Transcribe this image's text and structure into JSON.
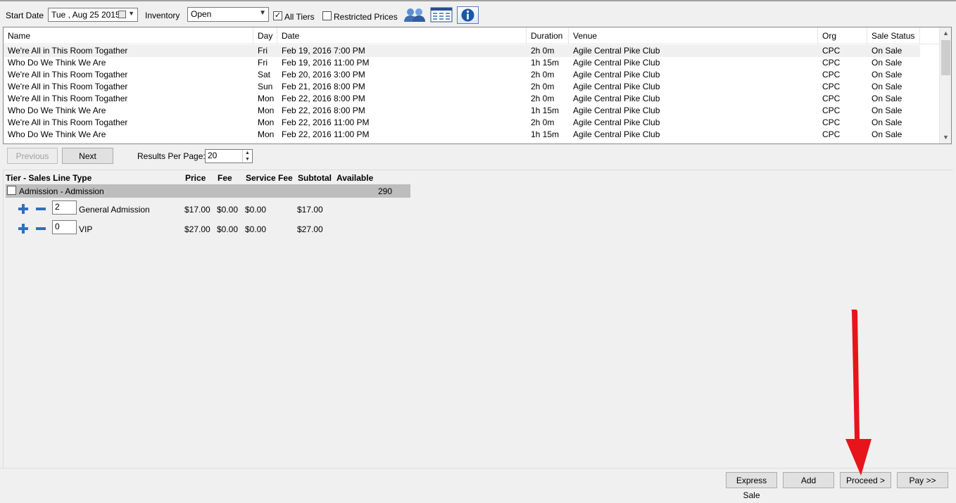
{
  "toolbar": {
    "start_date_label": "Start Date",
    "start_date_value": "Tue , Aug 25 2015",
    "inventory_label": "Inventory",
    "inventory_value": "Open",
    "all_tiers_label": "All Tiers",
    "all_tiers_checked": "✓",
    "restricted_prices_label": "Restricted Prices"
  },
  "events": {
    "columns": [
      "Name",
      "Day",
      "Date",
      "Duration",
      "Venue",
      "Org",
      "Sale Status"
    ],
    "rows": [
      [
        "We're All in This Room Togather",
        "Fri",
        "Feb 19, 2016 7:00 PM",
        "2h 0m",
        "Agile Central Pike Club",
        "CPC",
        "On Sale"
      ],
      [
        "Who Do We Think We Are",
        "Fri",
        "Feb 19, 2016 11:00 PM",
        "1h 15m",
        "Agile Central Pike Club",
        "CPC",
        "On Sale"
      ],
      [
        "We're All in This Room Togather",
        "Sat",
        "Feb 20, 2016 3:00 PM",
        "2h 0m",
        "Agile Central Pike Club",
        "CPC",
        "On Sale"
      ],
      [
        "We're All in This Room Togather",
        "Sun",
        "Feb 21, 2016 8:00 PM",
        "2h 0m",
        "Agile Central Pike Club",
        "CPC",
        "On Sale"
      ],
      [
        "We're All in This Room Togather",
        "Mon",
        "Feb 22, 2016 8:00 PM",
        "2h 0m",
        "Agile Central Pike Club",
        "CPC",
        "On Sale"
      ],
      [
        "Who Do We Think We Are",
        "Mon",
        "Feb 22, 2016 8:00 PM",
        "1h 15m",
        "Agile Central Pike Club",
        "CPC",
        "On Sale"
      ],
      [
        "We're All in This Room Togather",
        "Mon",
        "Feb 22, 2016 11:00 PM",
        "2h 0m",
        "Agile Central Pike Club",
        "CPC",
        "On Sale"
      ],
      [
        "Who Do We Think We Are",
        "Mon",
        "Feb 22, 2016 11:00 PM",
        "1h 15m",
        "Agile Central Pike Club",
        "CPC",
        "On Sale"
      ]
    ]
  },
  "pager": {
    "previous_label": "Previous",
    "next_label": "Next",
    "results_label": "Results Per Page:",
    "results_value": "20"
  },
  "tiers": {
    "headers": {
      "tier": "Tier - Sales Line Type",
      "price": "Price",
      "fee": "Fee",
      "service_fee": "Service Fee",
      "subtotal": "Subtotal",
      "available": "Available"
    },
    "group_label": "Admission - Admission",
    "group_available": "290",
    "lines": [
      {
        "qty": "2",
        "name": "General Admission",
        "price": "$17.00",
        "fee": "$0.00",
        "service_fee": "$0.00",
        "subtotal": "$17.00"
      },
      {
        "qty": "0",
        "name": "VIP",
        "price": "$27.00",
        "fee": "$0.00",
        "service_fee": "$0.00",
        "subtotal": "$27.00"
      }
    ]
  },
  "actions": {
    "express_sale": "Express Sale",
    "add": "Add",
    "proceed": "Proceed >",
    "pay": "Pay >>"
  },
  "colors": {
    "annotation_arrow": "#e8141b",
    "tier_group_bg": "#bdbdbd",
    "button_bg": "#e1e1e1"
  }
}
